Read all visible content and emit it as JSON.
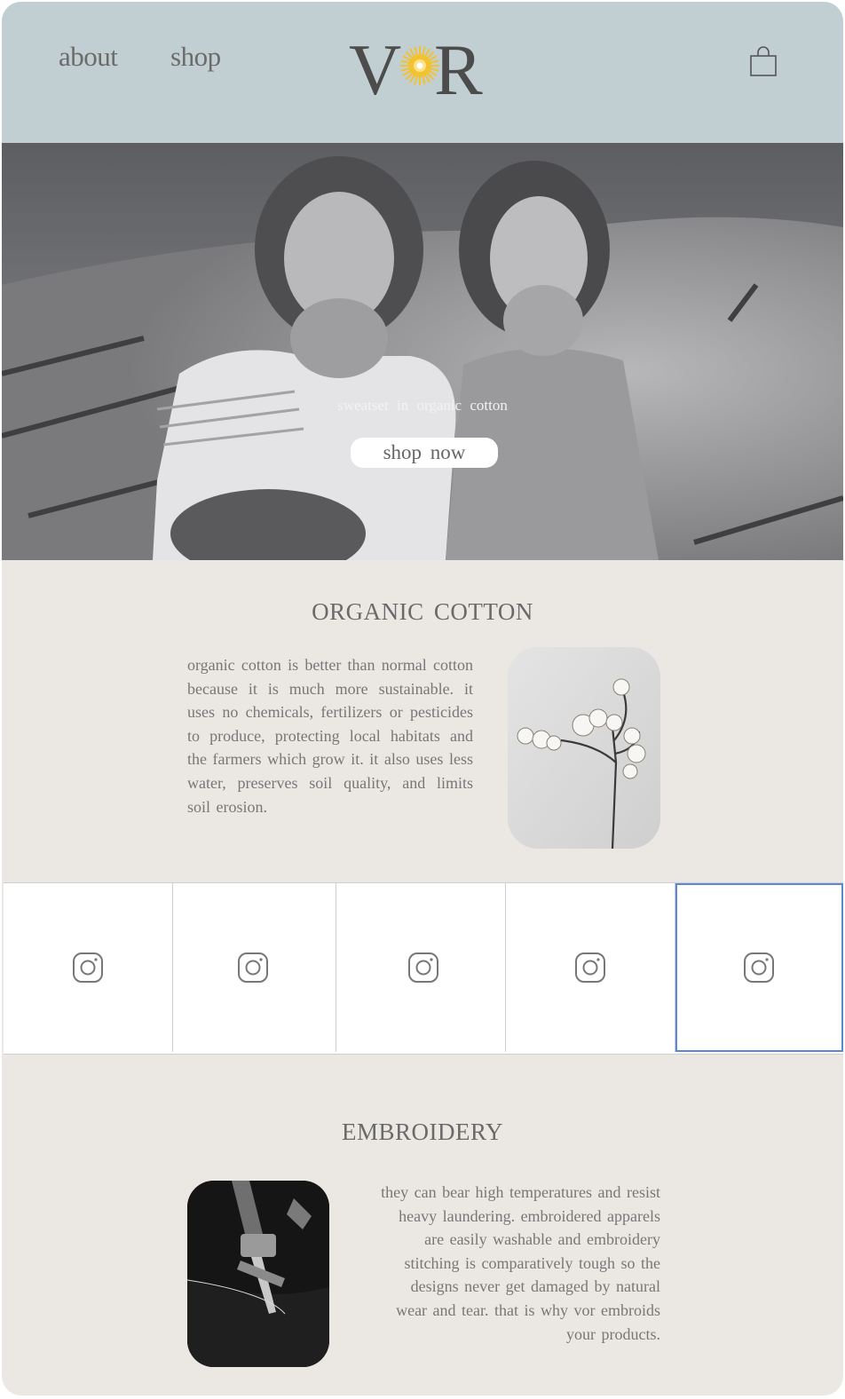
{
  "nav": {
    "about_label": "about",
    "shop_label": "shop"
  },
  "logo": {
    "text_v": "V",
    "text_r": "R",
    "sun_color": "#f2c230"
  },
  "header": {
    "cart_icon": "shopping-bag-icon",
    "background": "#c2cfd2"
  },
  "hero": {
    "caption": "sweatset in organic cotton",
    "button_label": "shop now"
  },
  "organic_cotton": {
    "title": "ORGANIC COTTON",
    "body": "organic cotton is better than normal cotton because it is much more sustainable. it uses no chemicals, fertilizers or pesticides to produce, protecting local habitats and the farmers which grow it. it also uses less water, preserves soil quality, and limits soil erosion."
  },
  "instagram": {
    "tiles": [
      {
        "icon": "instagram-icon"
      },
      {
        "icon": "instagram-icon"
      },
      {
        "icon": "instagram-icon"
      },
      {
        "icon": "instagram-icon"
      },
      {
        "icon": "instagram-icon",
        "selected": true
      }
    ],
    "selected_border_color": "#5b87d6"
  },
  "embroidery": {
    "title": "EMBROIDERY",
    "body": "they can bear high temperatures and resist heavy laundering. embroidered apparels are easily washable and embroidery stitching is comparatively tough so the designs never get damaged by natural wear and tear. that is why vor embroids your products."
  },
  "colors": {
    "page_background": "#ebe8e4",
    "text": "#777777",
    "accent": "#5b87d6"
  }
}
